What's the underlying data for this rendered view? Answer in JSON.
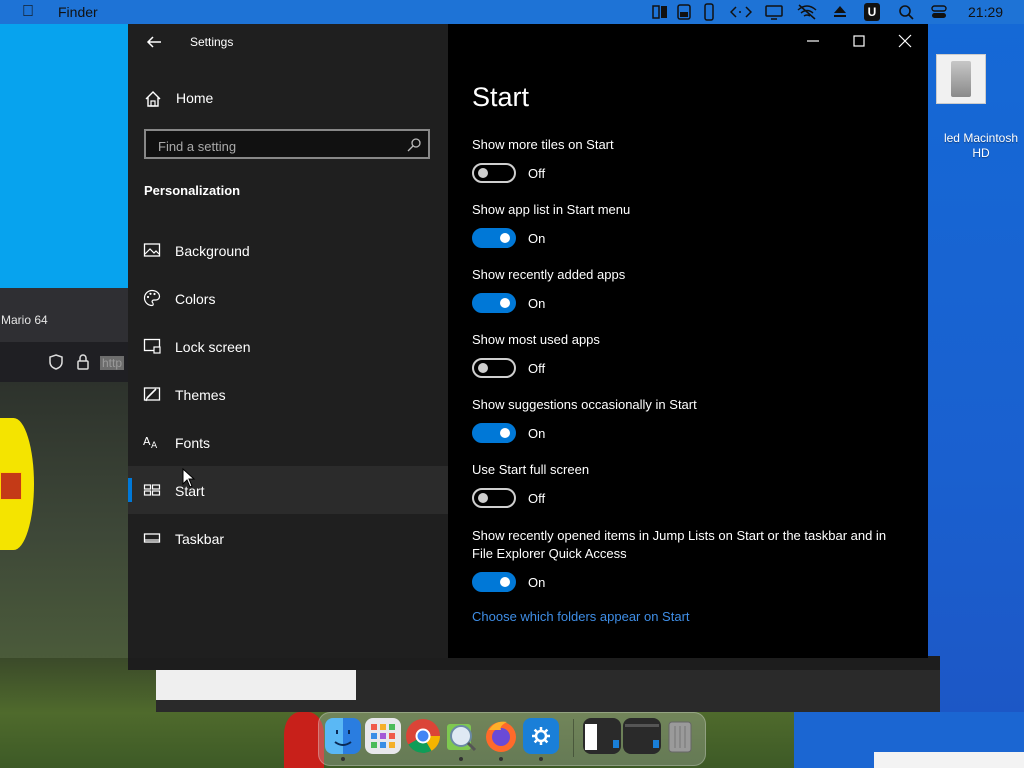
{
  "menubar": {
    "app_name": "Finder",
    "clock": "21:29",
    "u_badge": "U"
  },
  "desktop": {
    "hd_label": "led Macintosh HD",
    "browser_tab": "Mario 64",
    "browser_url": "http"
  },
  "window": {
    "title": "Settings",
    "home_label": "Home",
    "search_placeholder": "Find a setting",
    "section": "Personalization",
    "nav": [
      {
        "label": "Background",
        "icon": "picture-icon",
        "active": false
      },
      {
        "label": "Colors",
        "icon": "palette-icon",
        "active": false
      },
      {
        "label": "Lock screen",
        "icon": "lock-screen-icon",
        "active": false
      },
      {
        "label": "Themes",
        "icon": "themes-icon",
        "active": false
      },
      {
        "label": "Fonts",
        "icon": "fonts-icon",
        "active": false
      },
      {
        "label": "Start",
        "icon": "start-icon",
        "active": true
      },
      {
        "label": "Taskbar",
        "icon": "taskbar-icon",
        "active": false
      }
    ]
  },
  "content": {
    "title": "Start",
    "settings": [
      {
        "label": "Show more tiles on Start",
        "state": "Off"
      },
      {
        "label": "Show app list in Start menu",
        "state": "On"
      },
      {
        "label": "Show recently added apps",
        "state": "On"
      },
      {
        "label": "Show most used apps",
        "state": "Off"
      },
      {
        "label": "Show suggestions occasionally in Start",
        "state": "On"
      },
      {
        "label": "Use Start full screen",
        "state": "Off"
      },
      {
        "label": "Show recently opened items in Jump Lists on Start or the taskbar and in File Explorer Quick Access",
        "state": "On"
      }
    ],
    "link": "Choose which folders appear on Start"
  },
  "colors": {
    "accent": "#0078d7",
    "link": "#3f8ee6",
    "sidebar_bg": "#1f1f1f",
    "content_bg": "#000000"
  },
  "dock": {
    "items": [
      "finder-icon",
      "launchpad-icon",
      "chrome-icon",
      "preview-icon",
      "firefox-icon",
      "settings-icon",
      "window-thumb-1",
      "window-thumb-2",
      "trash-icon"
    ]
  }
}
